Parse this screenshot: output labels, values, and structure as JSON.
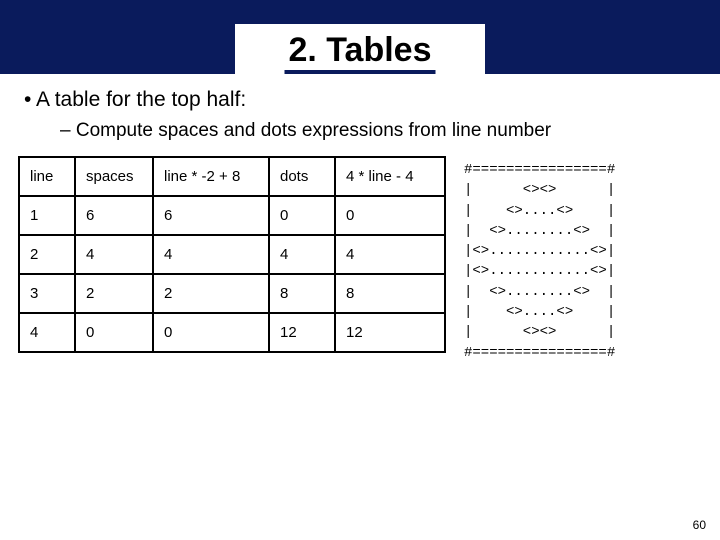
{
  "header": {
    "title": "2. Tables"
  },
  "bullets": {
    "b1": "A table for the top half:",
    "b2": "Compute spaces and dots expressions from line number"
  },
  "table": {
    "headers": {
      "h1": "line",
      "h2": "spaces",
      "h3": "line * -2 + 8",
      "h4": "dots",
      "h5": "4 * line - 4"
    },
    "rows": [
      {
        "c1": "1",
        "c2": "6",
        "c3": "6",
        "c4": "0",
        "c5": "0"
      },
      {
        "c1": "2",
        "c2": "4",
        "c3": "4",
        "c4": "4",
        "c5": "4"
      },
      {
        "c1": "3",
        "c2": "2",
        "c3": "2",
        "c4": "8",
        "c5": "8"
      },
      {
        "c1": "4",
        "c2": "0",
        "c3": "0",
        "c4": "12",
        "c5": "12"
      }
    ]
  },
  "ascii": "#================#\n|      <><>      |\n|    <>....<>    |\n|  <>........<>  |\n|<>............<>|\n|<>............<>|\n|  <>........<>  |\n|    <>....<>    |\n|      <><>      |\n#================#",
  "page_number": "60"
}
